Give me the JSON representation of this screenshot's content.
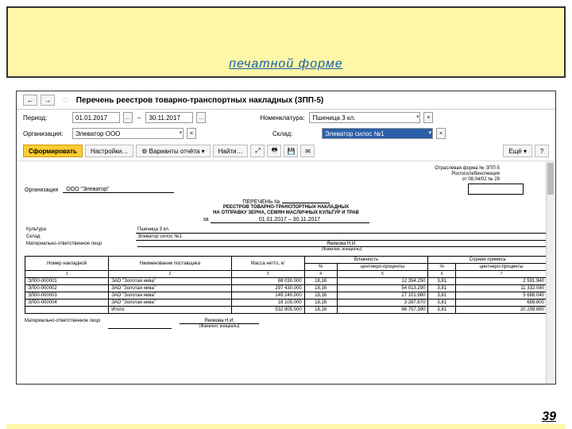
{
  "slide": {
    "header_link": "печатной форме",
    "page_number": "39"
  },
  "window": {
    "title": "Перечень реестров товарно-транспортных накладных (ЗПП-5)",
    "nav": {
      "back": "←",
      "fwd": "→"
    }
  },
  "filters": {
    "period_label": "Период:",
    "period_from": "01.01.2017",
    "period_to": "30.11.2017",
    "nomen_label": "Номенклатура:",
    "nomen_value": "Пшеница 3 кл.",
    "org_label": "Организация:",
    "org_value": "Элеватор ООО",
    "sklad_label": "Склад:",
    "sklad_value": "Элеватор силос №1"
  },
  "toolbar": {
    "form": "Сформировать",
    "settings": "Настройки…",
    "variants": "Варианты отчёта",
    "find": "Найти…",
    "more": "Ещё",
    "help": "?"
  },
  "report": {
    "form_line1": "Отраслевая форма № ЗПП-5",
    "form_line2": "Росгосхлебинспекция",
    "form_line3": "от 08.04/02 № 29",
    "org_label": "Организация",
    "org_value": "ООО \"Элеватор\"",
    "perechen": "ПЕРЕЧЕНЬ №",
    "title1": "РЕЕСТРОВ ТОВАРНО-ТРАНСПОРТНЫХ НАКЛАДНЫХ",
    "title2": "НА ОТПРАВКУ ЗЕРНА, СЕМЯН МАСЛИЧНЫХ КУЛЬТУР И ТРАВ",
    "za": "за",
    "period": "01.01.2017 – 30.11.2017",
    "kultura_label": "Культура",
    "kultura_value": "Пшеница 3 кл.",
    "sklad_label": "Склад",
    "sklad_value": "Элеватор силос №1",
    "mol_label": "Материально-ответственное лицо",
    "mol_value": "Якимова Н.И.",
    "mol_note": "(Фамилия, инициалы)",
    "sign_label": "Материально-ответственное лицо",
    "sign_value": "Якимова Н.И.",
    "sign_note": "(Фамилия, инициалы)"
  },
  "table": {
    "h_num": "Номер накладной",
    "h_sup": "Наименование поставщика",
    "h_mass": "Масса нетто, кг",
    "h_vl": "Влажность",
    "h_sor": "Сорная примесь",
    "h_pct": "%",
    "h_cp": "центнеро-проценты",
    "cols": [
      "1",
      "2",
      "3",
      "4",
      "5",
      "6",
      "7"
    ],
    "rows": [
      {
        "num": "ЭЛ00-000001",
        "sup": "ЗАО \"Золотая нива\"",
        "mass": "68 030.000",
        "vl_p": "18,16",
        "vl_cp": "12 354.250",
        "sor_p": "3,81",
        "sor_cp": "2 591.940"
      },
      {
        "num": "ЭЛ00-000002",
        "sup": "ЗАО \"Золотая нива\"",
        "mass": "297 430.000",
        "vl_p": "18,16",
        "vl_cp": "54 013.290",
        "sor_p": "3,81",
        "sor_cp": "11 332.080"
      },
      {
        "num": "ЭЛ00-000003",
        "sup": "ЗАО \"Золотая нива\"",
        "mass": "149 240.000",
        "vl_p": "18,16",
        "vl_cp": "27 101.980",
        "sor_p": "3,81",
        "sor_cp": "5 686.040"
      },
      {
        "num": "ЭЛ00-000004",
        "sup": "ЗАО \"Золотая нива\"",
        "mass": "18 105.000",
        "vl_p": "18,16",
        "vl_cp": "3 287.870",
        "sor_p": "3,81",
        "sor_cp": "689.800"
      }
    ],
    "total_label": "Итого:",
    "total": {
      "mass": "532 805.000",
      "vl_p": "18,16",
      "vl_cp": "96 757.390",
      "sor_p": "3,81",
      "sor_cp": "20 299.860"
    }
  }
}
